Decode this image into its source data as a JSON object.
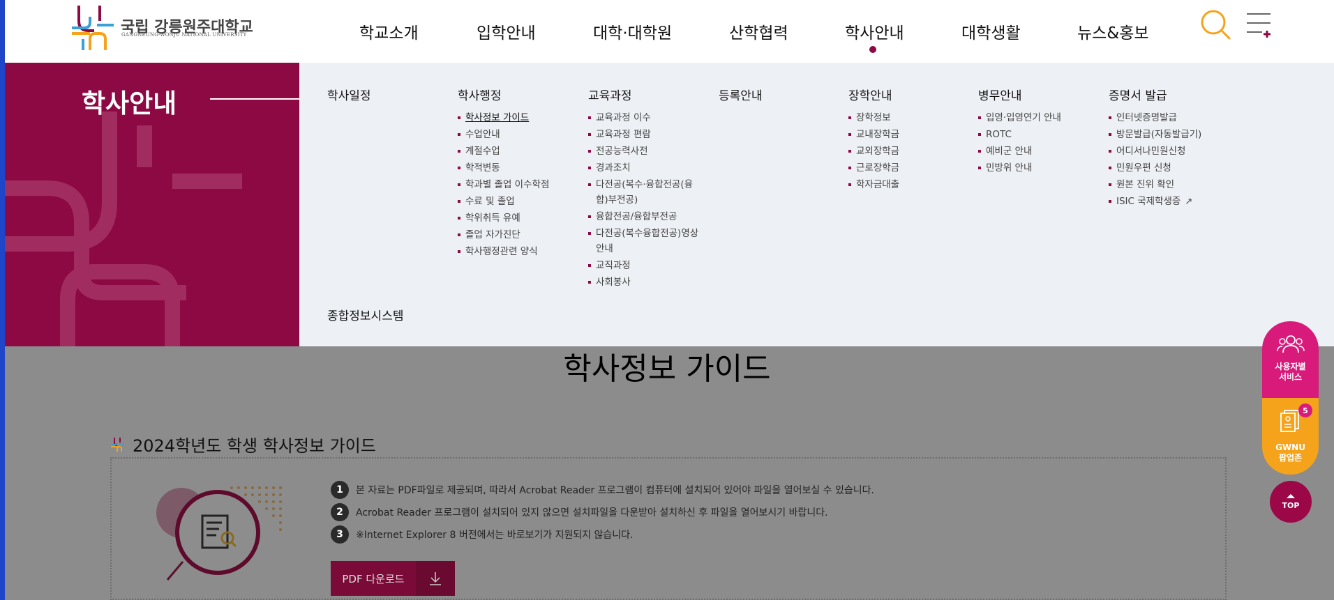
{
  "header": {
    "logo_ko": "국립 강릉원주대학교",
    "logo_en": "GANGNEUNG-WONJU NATIONAL UNIVERSITY",
    "nav": [
      {
        "label": "학교소개"
      },
      {
        "label": "입학안내"
      },
      {
        "label": "대학·대학원"
      },
      {
        "label": "산학협력"
      },
      {
        "label": "학사안내",
        "active": true
      },
      {
        "label": "대학생활"
      },
      {
        "label": "뉴스&홍보"
      }
    ],
    "search_icon": "search-icon",
    "menu_icon": "hamburger-menu-icon"
  },
  "mega_menu": {
    "title": "학사안내",
    "columns": [
      {
        "title": "학사일정",
        "items": []
      },
      {
        "title": "학사행정",
        "items": [
          "학사정보 가이드",
          "수업안내",
          "계절수업",
          "학적변동",
          "학과별 졸업 이수학점",
          "수료 및 졸업",
          "학위취득 유예",
          "졸업 자가진단",
          "학사행정관련 양식"
        ]
      },
      {
        "title": "교육과정",
        "items": [
          "교육과정 이수",
          "교육과정 편람",
          "전공능력사전",
          "경과조치",
          "다전공(복수·융합전공(융합)부전공)",
          "융합전공/융합부전공",
          "다전공(복수융합전공)영상안내",
          "교직과정",
          "사회봉사"
        ]
      },
      {
        "title": "등록안내",
        "items": []
      },
      {
        "title": "장학안내",
        "items": [
          "장학정보",
          "교내장학금",
          "교외장학금",
          "근로장학금",
          "학자금대출"
        ]
      },
      {
        "title": "병무안내",
        "items": [
          "입영·입영연기 안내",
          "ROTC",
          "예비군 안내",
          "민방위 안내"
        ]
      },
      {
        "title": "증명서 발급",
        "items": [
          "인터넷증명발급",
          "방문발급(자동발급기)",
          "어디서나민원신청",
          "민원우편 신청",
          "원본 진위 확인",
          "ISIC 국제학생증"
        ]
      }
    ],
    "extra": "종합정보시스템"
  },
  "page": {
    "title": "학사정보 가이드",
    "section_title": "2024학년도 학생 학사정보 가이드",
    "notes": [
      {
        "num": "1",
        "text": "본 자료는 PDF파일로 제공되며, 따라서 Acrobat Reader 프로그램이 컴퓨터에 설치되어 있어야 파일을 열어보실 수 있습니다."
      },
      {
        "num": "2",
        "text": "Acrobat Reader 프로그램이 설치되어 있지 않으면 설치파일을 다운받아 설치하신 후 파일을 열어보시기 바랍니다."
      },
      {
        "num": "3",
        "text": "※Internet Explorer 8 버전에서는 바로보기가 지원되지 않습니다."
      }
    ],
    "pdf_button": "PDF 다운로드"
  },
  "quick_menu": {
    "user_service": "사용자별\n서비스",
    "gwnu_app": "GWNU\n팝업존",
    "badge": "5",
    "top": "TOP"
  },
  "colors": {
    "brand": "#8c0943",
    "quick_pink": "#d81b7b",
    "quick_orange": "#f5a31a"
  }
}
